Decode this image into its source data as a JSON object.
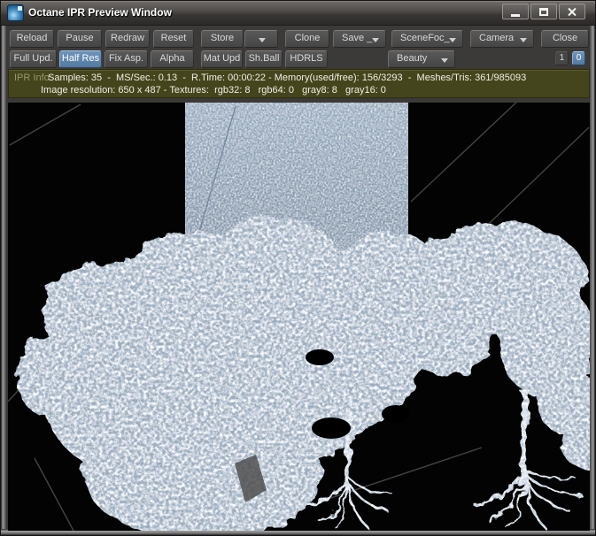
{
  "window": {
    "title": "Octane IPR Preview Window"
  },
  "titlebar_icons": [
    "octane-app-icon",
    "minimize",
    "maximize",
    "close"
  ],
  "toolbar": {
    "row1": {
      "reload": "Reload",
      "pause": "Pause",
      "redraw": "Redraw",
      "reset": "Reset",
      "store": "Store",
      "clone": "Clone",
      "save": "Save _",
      "scene_focus": "SceneFoc_",
      "camera": "Camera",
      "close": "Close"
    },
    "row2": {
      "full_update": "Full Upd.",
      "half_res": "Half Res",
      "fix_aspect": "Fix Asp.",
      "alpha": "Alpha",
      "mat_update": "Mat Upd",
      "shader_ball": "Sh.Ball",
      "hdrls": "HDRLS",
      "render_pass": "Beauty",
      "btn_one": "1",
      "btn_zero": "0"
    },
    "active_toggles": [
      "Half Res",
      "0"
    ]
  },
  "ipr_info": {
    "label": "IPR Info:",
    "line1": "Samples: 35  -  MS/Sec.: 0.13  -  R.Time: 00:00:22 - Memory(used/free): 156/3293  -  Meshes/Tris: 361/985093",
    "line2": "Image resolution: 650 x 487 - Textures:  rgb32: 8   rgb64: 0   gray8: 8   gray16: 0",
    "stats": {
      "samples": 35,
      "ms_per_sec": 0.13,
      "render_time": "00:00:22",
      "memory_used_free": "156/3293",
      "meshes_tris": "361/985093",
      "image_resolution": "650 x 487",
      "textures": {
        "rgb32": 8,
        "rgb64": 0,
        "gray8": 8,
        "gray16": 0
      }
    }
  },
  "viewport": {
    "render_description": "Noisy IPR preview: snow-white trees with trunks and roots, blue sky backdrop plane, black background with faint wireframe diagonals"
  },
  "colors": {
    "active_toggle": "#5b82ab",
    "info_bar_bg": "#45451d",
    "sky_band": "#8ba0b6",
    "canopy_base": "#9aabbc",
    "viewport_bg": "#030303"
  }
}
